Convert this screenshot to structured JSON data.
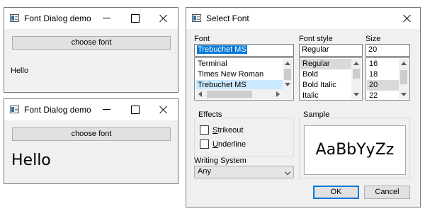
{
  "window1": {
    "title": "Font Dialog demo",
    "button_label": "choose font",
    "text": "Hello"
  },
  "window2": {
    "title": "Font Dialog demo",
    "button_label": "choose font",
    "text": "Hello"
  },
  "dialog": {
    "title": "Select Font",
    "font": {
      "label": "Font",
      "value": "Trebuchet MS",
      "items": [
        "Terminal",
        "Times New Roman",
        "Trebuchet MS"
      ],
      "selected": "Trebuchet MS"
    },
    "style": {
      "label": "Font style",
      "value": "Regular",
      "items": [
        "Regular",
        "Bold",
        "Bold Italic",
        "Italic"
      ],
      "selected": "Regular"
    },
    "size": {
      "label": "Size",
      "value": "20",
      "items": [
        "16",
        "18",
        "20",
        "22"
      ],
      "selected": "20"
    },
    "effects": {
      "label": "Effects",
      "strikeout": "Strikeout",
      "strikeout_checked": false,
      "underline": "Underline",
      "underline_checked": false
    },
    "writing_system": {
      "label": "Writing System",
      "value": "Any"
    },
    "sample": {
      "label": "Sample",
      "text": "AaBbYyZz"
    },
    "ok_label": "OK",
    "cancel_label": "Cancel"
  },
  "colors": {
    "selection_blue": "#0078d7",
    "list_highlight": "#cce8ff",
    "window_bg": "#f0f0f0"
  }
}
